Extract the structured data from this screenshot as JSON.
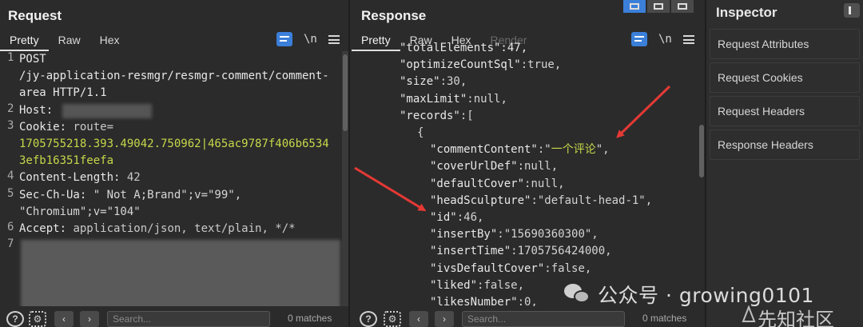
{
  "request": {
    "title": "Request",
    "tabs": [
      "Pretty",
      "Raw",
      "Hex"
    ],
    "active_tab": "Pretty",
    "toolbar": {
      "newline_label": "\\n"
    },
    "lines": [
      {
        "n": "1",
        "parts": [
          {
            "t": "POST",
            "c": "k"
          }
        ]
      },
      {
        "n": "",
        "parts": [
          {
            "t": "/jy-application-resmgr/resmgr-comment/comment-",
            "c": "k"
          }
        ]
      },
      {
        "n": "",
        "parts": [
          {
            "t": "area HTTP/1.1",
            "c": "k"
          }
        ]
      },
      {
        "n": "2",
        "parts": [
          {
            "t": "Host: ",
            "c": "k"
          }
        ]
      },
      {
        "n": "3",
        "parts": [
          {
            "t": "Cookie: ",
            "c": "k"
          },
          {
            "t": "route=",
            "c": "v"
          }
        ]
      },
      {
        "n": "",
        "parts": [
          {
            "t": "1705755218.393.49042.750962|465ac9787f406b6534",
            "c": "g"
          }
        ]
      },
      {
        "n": "",
        "parts": [
          {
            "t": "3efb16351feefa",
            "c": "g"
          }
        ]
      },
      {
        "n": "4",
        "parts": [
          {
            "t": "Content-Length: ",
            "c": "k"
          },
          {
            "t": "42",
            "c": "v"
          }
        ]
      },
      {
        "n": "5",
        "parts": [
          {
            "t": "Sec-Ch-Ua: ",
            "c": "k"
          },
          {
            "t": "\" Not A;Brand\";v=\"99\",",
            "c": "s"
          }
        ]
      },
      {
        "n": "",
        "parts": [
          {
            "t": "\"Chromium\";v=\"104\"",
            "c": "s"
          }
        ]
      },
      {
        "n": "6",
        "parts": [
          {
            "t": "Accept: ",
            "c": "k"
          },
          {
            "t": "application/json, text/plain, */*",
            "c": "v"
          }
        ]
      },
      {
        "n": "7",
        "parts": []
      }
    ],
    "footer": {
      "search_placeholder": "Search...",
      "matches": "0 matches"
    }
  },
  "response": {
    "title": "Response",
    "tabs": [
      "Pretty",
      "Raw",
      "Hex",
      "Render"
    ],
    "active_tab": "Pretty",
    "toolbar": {
      "newline_label": "\\n"
    },
    "lines": [
      {
        "indent": 60,
        "parts": [
          {
            "t": "\"totalElements\":47,",
            "c": "jk"
          }
        ]
      },
      {
        "indent": 60,
        "parts": [
          {
            "t": "\"optimizeCountSql\"",
            "c": "jk"
          },
          {
            "t": ":true,",
            "c": "jv"
          }
        ]
      },
      {
        "indent": 60,
        "parts": [
          {
            "t": "\"size\"",
            "c": "jk"
          },
          {
            "t": ":30,",
            "c": "jv"
          }
        ]
      },
      {
        "indent": 60,
        "parts": [
          {
            "t": "\"maxLimit\"",
            "c": "jk"
          },
          {
            "t": ":null,",
            "c": "jv"
          }
        ]
      },
      {
        "indent": 60,
        "parts": [
          {
            "t": "\"records\"",
            "c": "jk"
          },
          {
            "t": ":[",
            "c": "jv"
          }
        ]
      },
      {
        "indent": 82,
        "parts": [
          {
            "t": "{",
            "c": "jv"
          }
        ]
      },
      {
        "indent": 98,
        "parts": [
          {
            "t": "\"commentContent\"",
            "c": "jk"
          },
          {
            "t": ":\"",
            "c": "jv"
          },
          {
            "t": "一个评论",
            "c": "jcn"
          },
          {
            "t": "\",",
            "c": "jv"
          }
        ]
      },
      {
        "indent": 98,
        "parts": [
          {
            "t": "\"coverUrlDef\"",
            "c": "jk"
          },
          {
            "t": ":null,",
            "c": "jv"
          }
        ]
      },
      {
        "indent": 98,
        "parts": [
          {
            "t": "\"defaultCover\"",
            "c": "jk"
          },
          {
            "t": ":null,",
            "c": "jv"
          }
        ]
      },
      {
        "indent": 98,
        "parts": [
          {
            "t": "\"headSculpture\"",
            "c": "jk"
          },
          {
            "t": ":\"default-head-1\",",
            "c": "jv"
          }
        ]
      },
      {
        "indent": 98,
        "parts": [
          {
            "t": "\"id\"",
            "c": "jk"
          },
          {
            "t": ":46,",
            "c": "jv"
          }
        ]
      },
      {
        "indent": 98,
        "parts": [
          {
            "t": "\"insertBy\"",
            "c": "jk"
          },
          {
            "t": ":\"15690360300\",",
            "c": "jv"
          }
        ]
      },
      {
        "indent": 98,
        "parts": [
          {
            "t": "\"insertTime\"",
            "c": "jk"
          },
          {
            "t": ":1705756424000,",
            "c": "jv"
          }
        ]
      },
      {
        "indent": 98,
        "parts": [
          {
            "t": "\"ivsDefaultCover\"",
            "c": "jk"
          },
          {
            "t": ":false,",
            "c": "jv"
          }
        ]
      },
      {
        "indent": 98,
        "parts": [
          {
            "t": "\"liked\"",
            "c": "jk"
          },
          {
            "t": ":false,",
            "c": "jv"
          }
        ]
      },
      {
        "indent": 98,
        "parts": [
          {
            "t": "\"likesNumber\"",
            "c": "jk"
          },
          {
            "t": ":0,",
            "c": "jv"
          }
        ]
      }
    ],
    "footer": {
      "search_placeholder": "Search...",
      "matches": "0 matches"
    }
  },
  "inspector": {
    "title": "Inspector",
    "items": [
      "Request Attributes",
      "Request Cookies",
      "Request Headers",
      "Response Headers"
    ]
  },
  "watermark": {
    "text": "公众号 · growing0101",
    "site": "先知社区"
  },
  "colors": {
    "accent": "#3b7fd9",
    "string_green": "#c6d84a",
    "arrow": "#e53935"
  }
}
